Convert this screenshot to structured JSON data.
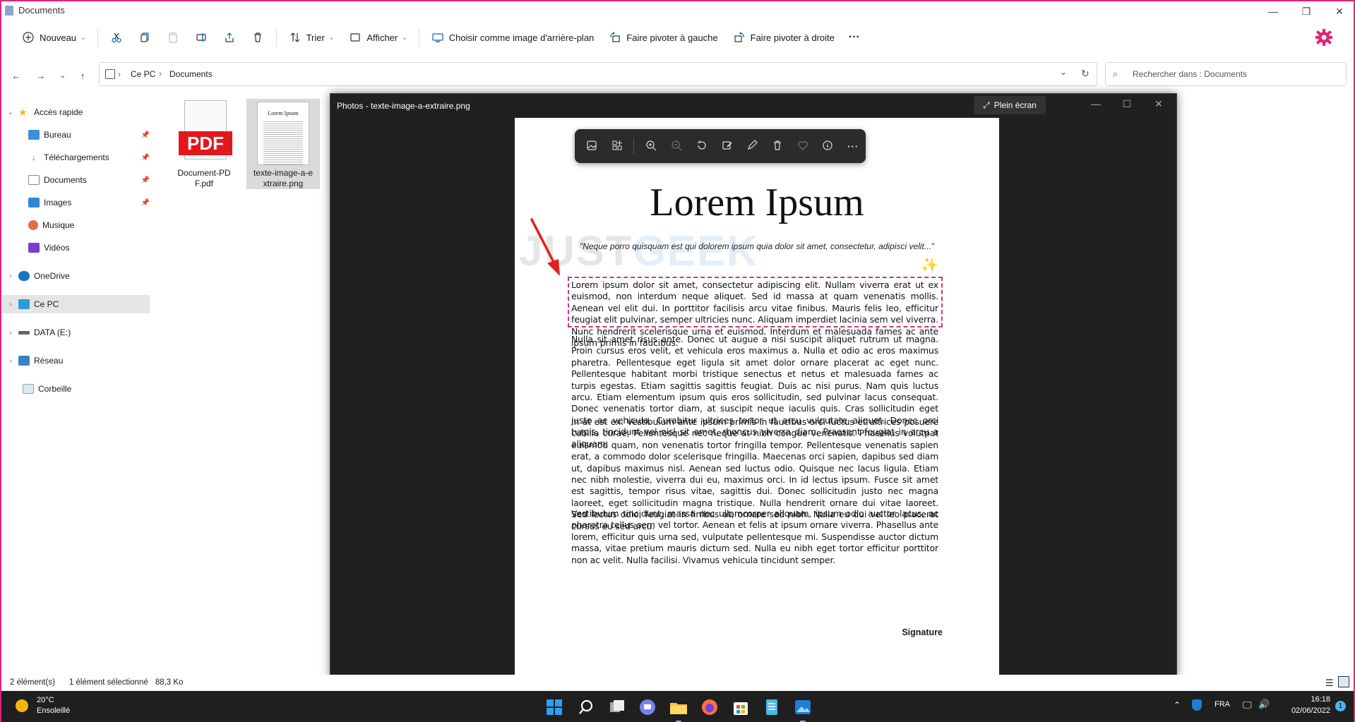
{
  "window": {
    "title": "Documents"
  },
  "toolbar": {
    "new_label": "Nouveau",
    "sort_label": "Trier",
    "view_label": "Afficher",
    "set_bg_label": "Choisir comme image d'arrière-plan",
    "rotate_left_label": "Faire pivoter à gauche",
    "rotate_right_label": "Faire pivoter à droite",
    "more_label": "···"
  },
  "address": {
    "crumb1": "Ce PC",
    "crumb2": "Documents",
    "search_placeholder": "Rechercher dans : Documents"
  },
  "sidebar": {
    "items": [
      {
        "label": "Accès rapide"
      },
      {
        "label": "Bureau"
      },
      {
        "label": "Téléchargements"
      },
      {
        "label": "Documents"
      },
      {
        "label": "Images"
      },
      {
        "label": "Musique"
      },
      {
        "label": "Vidéos"
      },
      {
        "label": "OneDrive"
      },
      {
        "label": "Ce PC"
      },
      {
        "label": "DATA (E:)"
      },
      {
        "label": "Réseau"
      },
      {
        "label": "Corbeille"
      }
    ]
  },
  "files": [
    {
      "name": "Document-PDF.pdf",
      "badge": "PDF"
    },
    {
      "name": "texte-image-a-extraire.png",
      "thumb_title": "Lorem Ipsum"
    }
  ],
  "status": {
    "count": "2 élément(s)",
    "selected": "1 élément sélectionné",
    "size": "88,3 Ko"
  },
  "photos": {
    "title": "Photos - texte-image-a-extraire.png",
    "fullscreen_label": "Plein écran",
    "doc": {
      "heading": "Lorem Ipsum",
      "quote": "\"Neque porro quisquam est qui dolorem ipsum quia dolor sit amet, consectetur, adipisci velit...\"",
      "watermark1": "JUST",
      "watermark2": "GEEK",
      "p1": "Lorem ipsum dolor sit amet, consectetur adipiscing elit. Nullam viverra erat ut ex euismod, non interdum neque aliquet. Sed id massa at quam venenatis mollis. Aenean vel elit dui. In porttitor facilisis arcu vitae finibus. Mauris felis leo, efficitur feugiat elit pulvinar, semper ultricies nunc. Aliquam imperdiet lacinia sem vel viverra. Nunc hendrerit scelerisque urna et euismod. Interdum et malesuada fames ac ante ipsum primis in faucibus.",
      "p2": "Nulla sit amet risus ante. Donec ut augue a nisi suscipit aliquet rutrum ut magna. Proin cursus eros velit, et vehicula eros maximus a. Nulla et odio ac eros maximus pharetra. Pellentesque eget ligula sit amet dolor ornare placerat ac eget nunc. Pellentesque habitant morbi tristique senectus et netus et malesuada fames ac turpis egestas. Etiam sagittis sagittis feugiat. Duis ac nisi purus. Nam quis luctus arcu. Etiam elementum ipsum quis eros sollicitudin, sed pulvinar lacus consequat. Donec venenatis tortor diam, at suscipit neque iaculis quis. Cras sollicitudin eget justo ac vehicula. Curabitur ultrices tortor ut arcu vulputate aliquet. Donec orci turpis, tincidunt vel nisl sit amet, rhoncus viverra diam. Praesent feugiat in arcu a aliquam.",
      "p3": "In at est ex. Vestibulum ante ipsum primis in faucibus orci luctus et ultrices posuere cubilia curae; Pellentesque nec neque at nibh congue venenatis. Phasellus volutpat euismod quam, non venenatis tortor fringilla tempor. Pellentesque venenatis sapien erat, a commodo dolor scelerisque fringilla. Maecenas orci sapien, dapibus sed diam ut, dapibus maximus nisl. Aenean sed luctus odio. Quisque nec lacus ligula. Etiam nec nibh molestie, viverra dui eu, maximus orci. In id lectus ipsum. Fusce sit amet est sagittis, tempor risus vitae, sagittis dui. Donec sollicitudin justo nec magna laoreet, eget sollicitudin magna tristique. Nulla hendrerit ornare dui vitae laoreet. Sed lectus odio, feugiat in finibus at, ornare sed nibh. Nulla eu dui vel leo placerat cursus eu sed arcu.",
      "p4": "Vestibulum tincidunt, massa nec ullamcorper aliquam, ipsum odio auctor lacus, ac pharetra tellus sem vel tortor. Aenean et felis at ipsum ornare viverra. Phasellus ante lorem, efficitur quis urna sed, vulputate pellentesque mi. Suspendisse auctor dictum massa, vitae pretium mauris dictum sed. Nulla eu nibh eget tortor efficitur porttitor non ac velit. Nulla facilisi. Vivamus vehicula tincidunt semper.",
      "signature": "Signature"
    }
  },
  "taskbar": {
    "temp": "20°C",
    "weather": "Ensoleillé",
    "lang": "FRA",
    "time": "16:18",
    "date": "02/06/2022",
    "notif": "1"
  },
  "colors": {
    "accent": "#0067c0",
    "selection": "#d0357a",
    "pdf_red": "#e3171b",
    "arrow": "#e0201c"
  }
}
